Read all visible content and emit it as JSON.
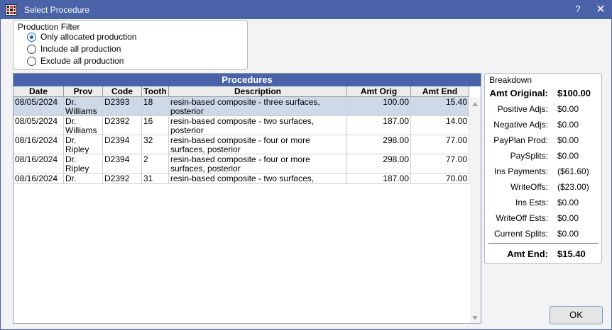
{
  "window": {
    "title": "Select Procedure",
    "help_label": "?",
    "close_label": "✕"
  },
  "production_filter": {
    "title": "Production Filter",
    "options": [
      {
        "label": "Only allocated production",
        "checked": true
      },
      {
        "label": "Include all production",
        "checked": false
      },
      {
        "label": "Exclude all production",
        "checked": false
      }
    ]
  },
  "procedures": {
    "title": "Procedures",
    "columns": [
      "Date",
      "Prov",
      "Code",
      "Tooth",
      "Description",
      "Amt Orig",
      "Amt End"
    ],
    "rows": [
      {
        "date": "08/05/2024",
        "prov": "Dr. Williams",
        "code": "D2393",
        "tooth": "18",
        "description": "resin-based composite - three surfaces, posterior",
        "amt_orig": "100.00",
        "amt_end": "15.40",
        "selected": true
      },
      {
        "date": "08/05/2024",
        "prov": "Dr. Williams",
        "code": "D2392",
        "tooth": "16",
        "description": "resin-based composite - two surfaces, posterior",
        "amt_orig": "187.00",
        "amt_end": "14.00",
        "selected": false
      },
      {
        "date": "08/16/2024",
        "prov": "Dr. Ripley",
        "code": "D2394",
        "tooth": "32",
        "description": "resin-based composite - four or more surfaces, posterior",
        "amt_orig": "298.00",
        "amt_end": "77.00",
        "selected": false
      },
      {
        "date": "08/16/2024",
        "prov": "Dr. Ripley",
        "code": "D2394",
        "tooth": "2",
        "description": "resin-based composite - four or more surfaces, posterior",
        "amt_orig": "298.00",
        "amt_end": "77.00",
        "selected": false
      },
      {
        "date": "08/16/2024",
        "prov": "Dr. Ripley",
        "code": "D2392",
        "tooth": "31",
        "description": "resin-based composite - two surfaces, posterior",
        "amt_orig": "187.00",
        "amt_end": "70.00",
        "selected": false
      }
    ]
  },
  "breakdown": {
    "title": "Breakdown",
    "items": [
      {
        "label": "Amt Original:",
        "value": "$100.00",
        "bold": true
      },
      {
        "label": "Positive Adjs:",
        "value": "$0.00",
        "bold": false
      },
      {
        "label": "Negative Adjs:",
        "value": "$0.00",
        "bold": false
      },
      {
        "label": "PayPlan Prod:",
        "value": "$0.00",
        "bold": false
      },
      {
        "label": "PaySplits:",
        "value": "$0.00",
        "bold": false
      },
      {
        "label": "Ins Payments:",
        "value": "($61.60)",
        "bold": false
      },
      {
        "label": "WriteOffs:",
        "value": "($23.00)",
        "bold": false
      },
      {
        "label": "Ins Ests:",
        "value": "$0.00",
        "bold": false
      },
      {
        "label": "WriteOff Ests:",
        "value": "$0.00",
        "bold": false
      },
      {
        "label": "Current Splits:",
        "value": "$0.00",
        "bold": false
      }
    ],
    "total": {
      "label": "Amt End:",
      "value": "$15.40"
    }
  },
  "ok_label": "OK"
}
